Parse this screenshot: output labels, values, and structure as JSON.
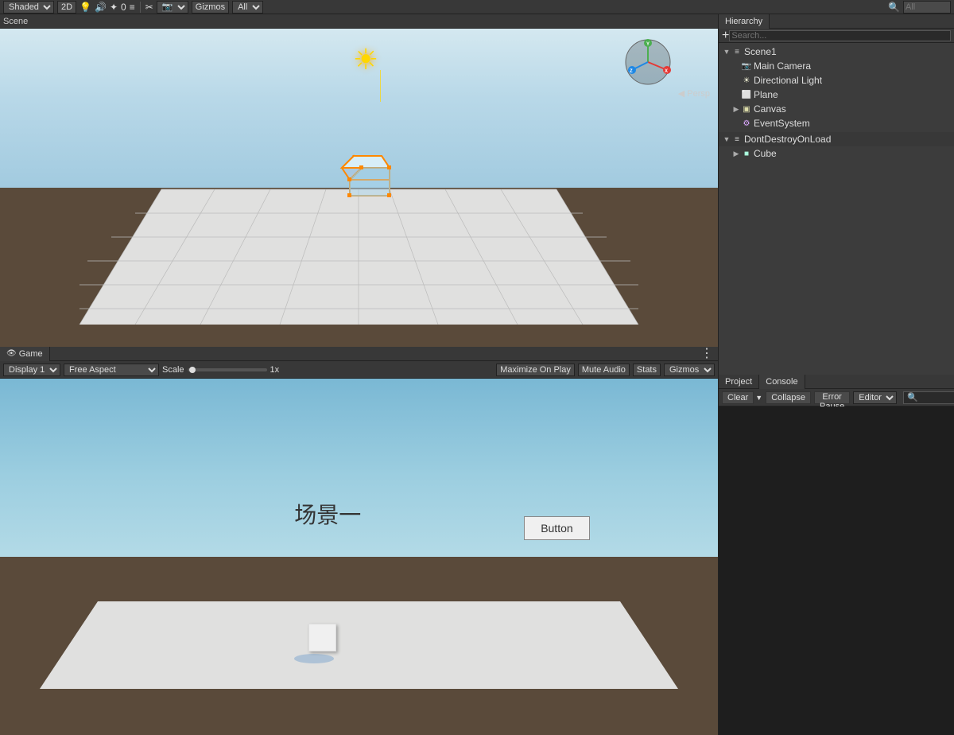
{
  "toolbar": {
    "shading_label": "Shaded",
    "2d_label": "2D",
    "gizmos_label": "Gizmos",
    "all_label": "All",
    "search_placeholder": "All"
  },
  "scene_view": {
    "persp_label": "◀ Persp",
    "sun_icon": "☀"
  },
  "game_view": {
    "tab_label": "Game",
    "display_label": "Display 1",
    "aspect_label": "Free Aspect",
    "scale_label": "Scale",
    "scale_value": "1x",
    "maximize_label": "Maximize On Play",
    "mute_label": "Mute Audio",
    "stats_label": "Stats",
    "gizmos_label": "Gizmos",
    "scene_text": "场景一",
    "button_label": "Button",
    "menu_dots": "⋮"
  },
  "hierarchy": {
    "scene_name": "Scene1",
    "add_icon": "+",
    "search_placeholder": "Search...",
    "items": [
      {
        "name": "Scene1",
        "level": 0,
        "has_arrow": true,
        "arrow": "▼",
        "icon": "scene",
        "is_root": true
      },
      {
        "name": "Main Camera",
        "level": 1,
        "has_arrow": false,
        "icon": "camera"
      },
      {
        "name": "Directional Light",
        "level": 1,
        "has_arrow": false,
        "icon": "light"
      },
      {
        "name": "Plane",
        "level": 1,
        "has_arrow": false,
        "icon": "plane"
      },
      {
        "name": "Canvas",
        "level": 1,
        "has_arrow": true,
        "arrow": "▶",
        "icon": "canvas"
      },
      {
        "name": "EventSystem",
        "level": 1,
        "has_arrow": false,
        "icon": "event"
      },
      {
        "name": "DontDestroyOnLoad",
        "level": 0,
        "has_arrow": true,
        "arrow": "▼",
        "icon": "scene",
        "is_section": true
      },
      {
        "name": "Cube",
        "level": 1,
        "has_arrow": true,
        "arrow": "▶",
        "icon": "cube",
        "is_selected": false
      }
    ]
  },
  "console": {
    "project_tab": "Project",
    "console_tab": "Console",
    "clear_label": "Clear",
    "collapse_label": "Collapse",
    "error_pause_label": "Error Pause",
    "editor_label": "Editor",
    "search_placeholder": "🔍"
  }
}
